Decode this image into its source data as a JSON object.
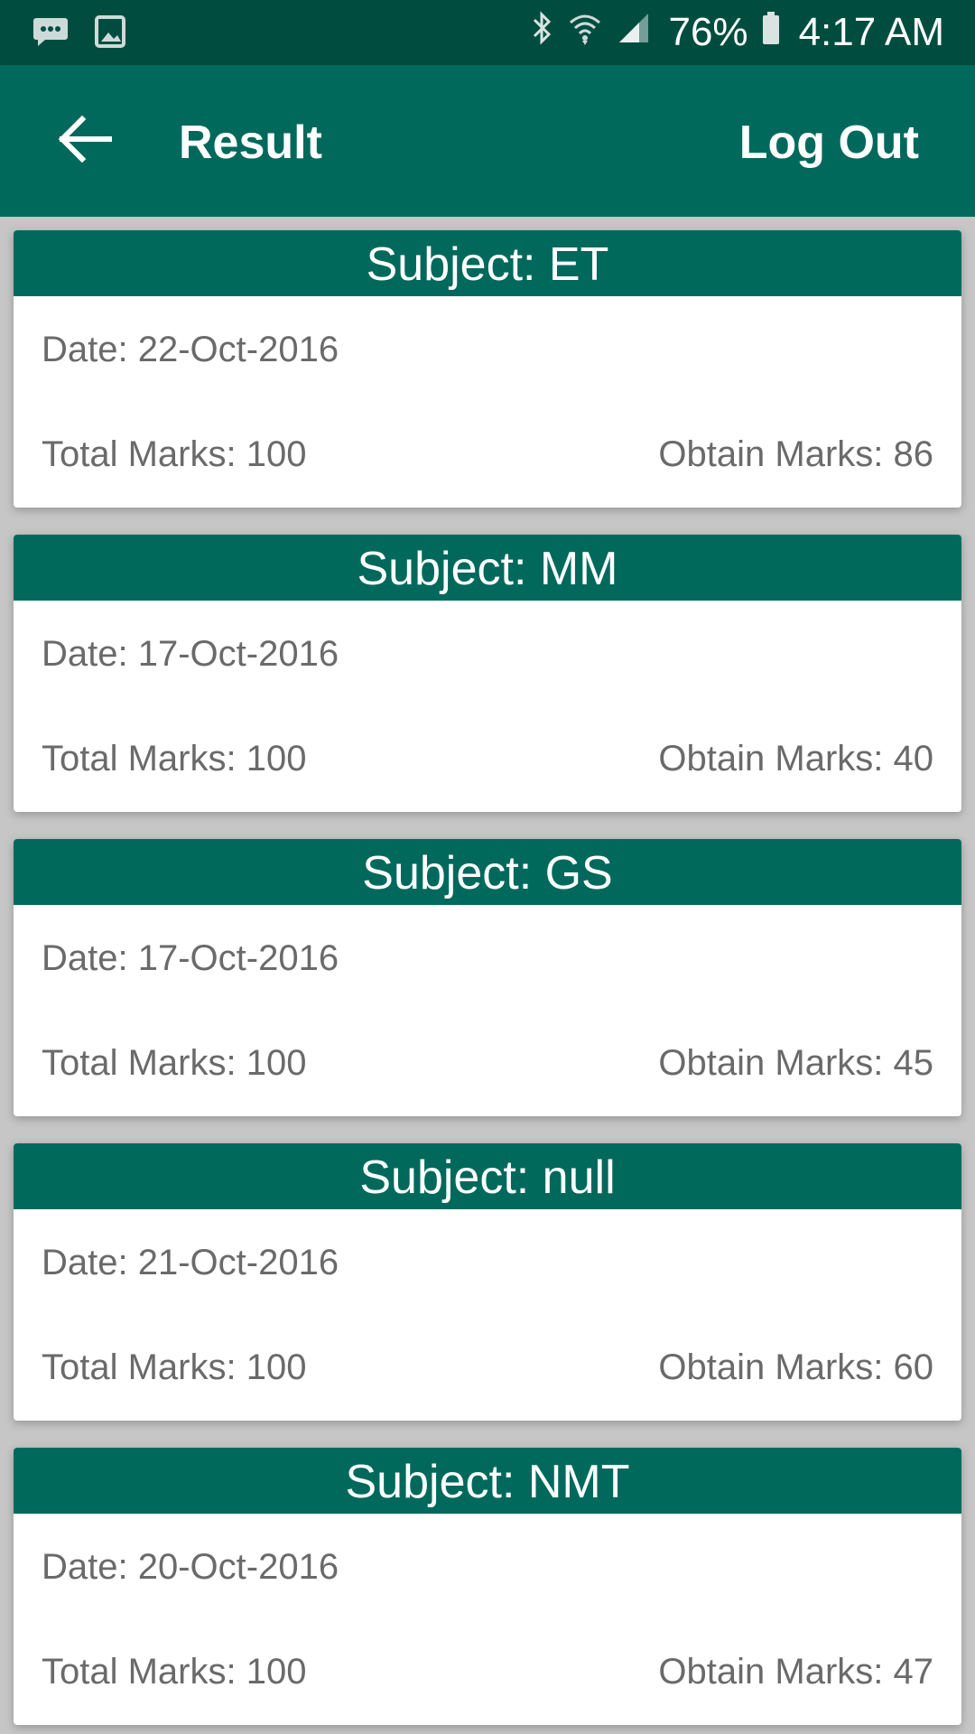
{
  "status_bar": {
    "icons": [
      "message-icon",
      "gallery-icon",
      "bluetooth-icon",
      "wifi-icon",
      "signal-icon",
      "battery-icon"
    ],
    "battery": "76%",
    "time": "4:17 AM"
  },
  "app_bar": {
    "back_icon": "arrow-back-icon",
    "title": "Result",
    "logout_label": "Log Out"
  },
  "colors": {
    "status_bar": "#004d40",
    "primary": "#00695c",
    "text_secondary": "#6a6a6a"
  },
  "results": [
    {
      "subject": "Subject: ET",
      "date": "Date: 22-Oct-2016",
      "total": "Total Marks: 100",
      "obtain": "Obtain Marks: 86"
    },
    {
      "subject": "Subject: MM",
      "date": "Date: 17-Oct-2016",
      "total": "Total Marks: 100",
      "obtain": "Obtain Marks: 40"
    },
    {
      "subject": "Subject: GS",
      "date": "Date: 17-Oct-2016",
      "total": "Total Marks: 100",
      "obtain": "Obtain Marks: 45"
    },
    {
      "subject": "Subject: null",
      "date": "Date: 21-Oct-2016",
      "total": "Total Marks: 100",
      "obtain": "Obtain Marks: 60"
    },
    {
      "subject": "Subject: NMT",
      "date": "Date: 20-Oct-2016",
      "total": "Total Marks: 100",
      "obtain": "Obtain Marks: 47"
    }
  ]
}
